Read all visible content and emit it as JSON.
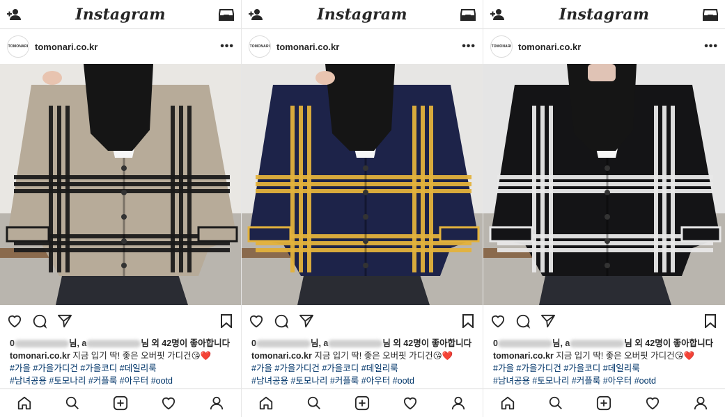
{
  "panels": [
    {
      "id": "beige",
      "app_title": "Instagram",
      "avatar_text": "TOMONARI",
      "username": "tomonari.co.kr",
      "more": "•••",
      "likes": {
        "prefix": "0",
        "mid": "님, a",
        "suffix": "님 외 42명이 좋아합니다"
      },
      "caption": {
        "user": "tomonari.co.kr",
        "text": "지금 입기 딱! 좋은 오버핏 가디건😘❤️"
      },
      "tags_line1": "#가을 #가을가디건 #가을코디 #데일리룩",
      "tags_line2": "#남녀공용 #토모나리 #커플룩 #아우터 #ootd",
      "colors": {
        "cardigan": "#b7ab99",
        "stripe": "#1a1a1a",
        "bg": "#e9e7e3"
      }
    },
    {
      "id": "navy",
      "app_title": "Instagram",
      "avatar_text": "TOMONARI",
      "username": "tomonari.co.kr",
      "more": "•••",
      "likes": {
        "prefix": "0",
        "mid": "님, a",
        "suffix": "님 외 42명이 좋아합니다"
      },
      "caption": {
        "user": "tomonari.co.kr",
        "text": "지금 입기 딱! 좋은 오버핏 가디건😘❤️"
      },
      "tags_line1": "#가을 #가을가디건 #가을코디 #데일리룩",
      "tags_line2": "#남녀공용 #토모나리 #커플룩 #아우터 #ootd",
      "colors": {
        "cardigan": "#1d2349",
        "stripe": "#e3b23c",
        "bg": "#e7e6e4"
      }
    },
    {
      "id": "black",
      "app_title": "Instagram",
      "avatar_text": "TOMONARI",
      "username": "tomonari.co.kr",
      "more": "•••",
      "likes": {
        "prefix": "0",
        "mid": "님, a",
        "suffix": "님 외 42명이 좋아합니다"
      },
      "caption": {
        "user": "tomonari.co.kr",
        "text": "지금 입기 딱! 좋은 오버핏 가디건😘❤️"
      },
      "tags_line1": "#가을 #가을가디건 #가을코디 #데일리룩",
      "tags_line2": "#남녀공용 #토모나리 #커플룩 #아우터 #ootd",
      "colors": {
        "cardigan": "#141416",
        "stripe": "#e8e8e8",
        "bg": "#e5e5e5"
      }
    }
  ],
  "icons": {
    "top_left": "add-user-icon",
    "top_right": "inbox-icon",
    "actions": [
      "heart-icon",
      "comment-icon",
      "share-icon",
      "bookmark-icon"
    ],
    "nav": [
      "home-icon",
      "search-icon",
      "new-post-icon",
      "activity-heart-icon",
      "profile-icon"
    ]
  }
}
